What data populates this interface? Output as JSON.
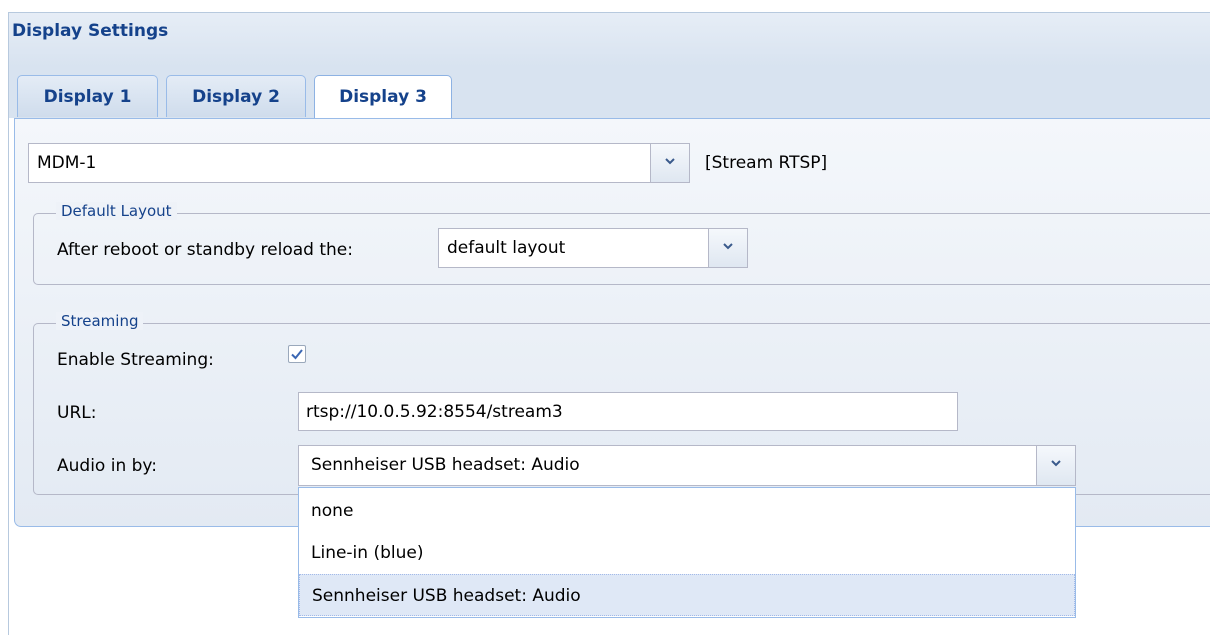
{
  "panel": {
    "title": "Display Settings"
  },
  "tabs": [
    {
      "label": "Display 1",
      "active": false
    },
    {
      "label": "Display 2",
      "active": false
    },
    {
      "label": "Display 3",
      "active": true
    }
  ],
  "display_select": {
    "value": "MDM-1",
    "status": "[Stream RTSP]"
  },
  "default_layout": {
    "legend": "Default Layout",
    "reload_label": "After reboot or standby reload the:",
    "reload_value": "default layout"
  },
  "streaming": {
    "legend": "Streaming",
    "enable_label": "Enable Streaming:",
    "enable_checked": true,
    "url_label": "URL:",
    "url_value": "rtsp://10.0.5.92:8554/stream3",
    "audio_label": "Audio in by:",
    "audio_value": "Sennheiser USB headset: Audio",
    "audio_options": [
      "none",
      "Line-in (blue)",
      "Sennheiser USB headset: Audio"
    ],
    "audio_selected_index": 2
  },
  "colors": {
    "header_text": "#15428b",
    "border": "#99bbe8",
    "selected_option": "#dfe8f6"
  }
}
